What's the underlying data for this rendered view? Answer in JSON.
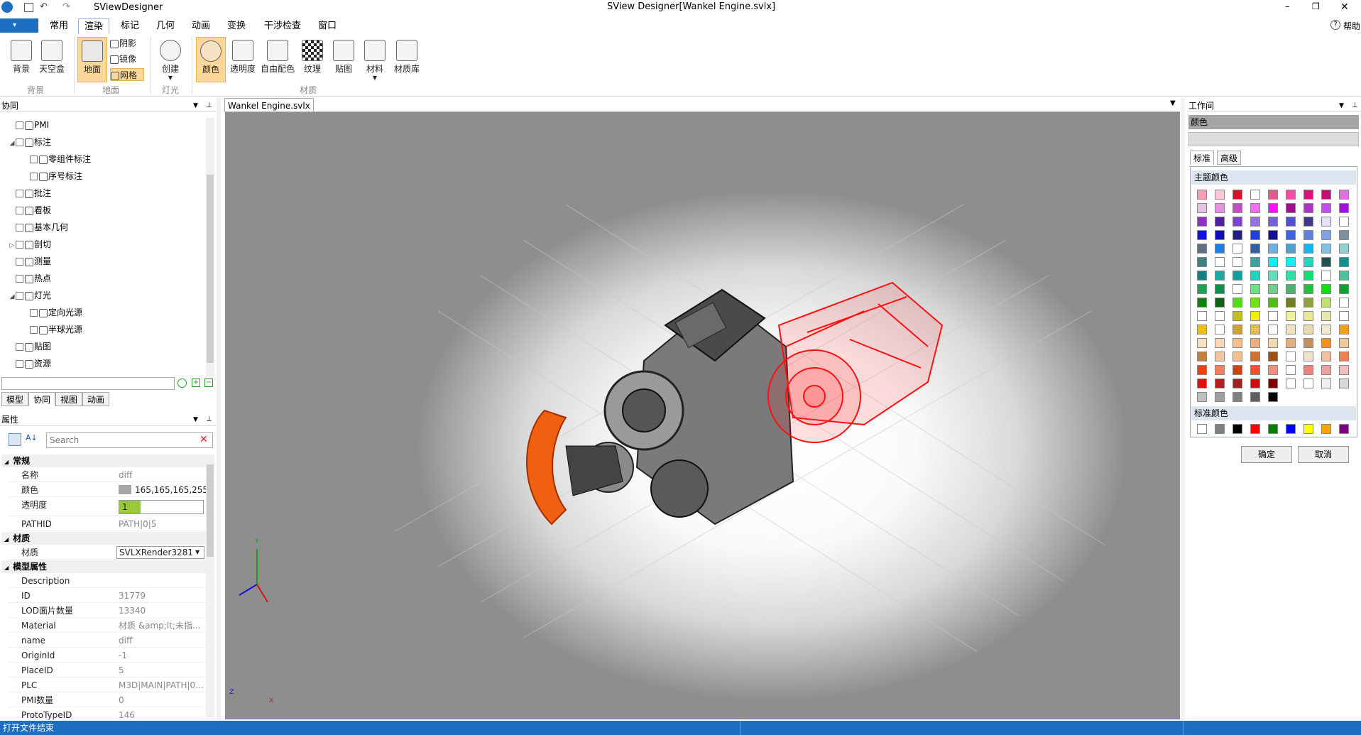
{
  "window": {
    "app_name": "SViewDesigner",
    "title": "SView Designer[Wankel Engine.svlx]",
    "help": "帮助"
  },
  "ribbon": {
    "tabs": [
      "常用",
      "渲染",
      "标记",
      "几何",
      "动画",
      "变换",
      "干涉检查",
      "窗口"
    ],
    "active_tab": "渲染",
    "groups": [
      {
        "name": "背景",
        "buttons": [
          "背景",
          "天空盒"
        ]
      },
      {
        "name": "地面",
        "buttons": [
          "地面"
        ],
        "small": [
          "阴影",
          "镜像",
          "网格"
        ]
      },
      {
        "name": "灯光",
        "buttons": [
          "创建"
        ]
      },
      {
        "name": "材质",
        "buttons": [
          "颜色",
          "透明度",
          "自由配色",
          "纹理",
          "贴图",
          "材料",
          "材质库"
        ]
      }
    ]
  },
  "left_top": {
    "header": "协同",
    "tree": [
      {
        "label": "PMI",
        "level": 0,
        "expander": ""
      },
      {
        "label": "标注",
        "level": 0,
        "expander": "◢"
      },
      {
        "label": "零组件标注",
        "level": 1,
        "expander": ""
      },
      {
        "label": "序号标注",
        "level": 1,
        "expander": ""
      },
      {
        "label": "批注",
        "level": 0,
        "expander": ""
      },
      {
        "label": "看板",
        "level": 0,
        "expander": ""
      },
      {
        "label": "基本几何",
        "level": 0,
        "expander": ""
      },
      {
        "label": "剖切",
        "level": 0,
        "expander": "▷"
      },
      {
        "label": "测量",
        "level": 0,
        "expander": ""
      },
      {
        "label": "热点",
        "level": 0,
        "expander": ""
      },
      {
        "label": "灯光",
        "level": 0,
        "expander": "◢"
      },
      {
        "label": "定向光源",
        "level": 1,
        "expander": ""
      },
      {
        "label": "半球光源",
        "level": 1,
        "expander": ""
      },
      {
        "label": "贴图",
        "level": 0,
        "expander": ""
      },
      {
        "label": "资源",
        "level": 0,
        "expander": ""
      }
    ],
    "bottom_tabs": [
      "模型",
      "协同",
      "视图",
      "动画"
    ],
    "active_bottom_tab": "协同"
  },
  "properties": {
    "header": "属性",
    "search_placeholder": "Search",
    "categories": [
      {
        "name": "常规",
        "rows": [
          {
            "key": "名称",
            "value": "diff"
          },
          {
            "key": "颜色",
            "value": "165,165,165,255"
          },
          {
            "key": "透明度",
            "value": "1"
          },
          {
            "key": "PATHID",
            "value": "PATH|0|5"
          }
        ]
      },
      {
        "name": "材质",
        "rows": [
          {
            "key": "材质",
            "value": "SVLXRender3281"
          }
        ]
      },
      {
        "name": "模型属性",
        "rows": [
          {
            "key": "Description",
            "value": ""
          },
          {
            "key": "ID",
            "value": "31779"
          },
          {
            "key": "LOD面片数量",
            "value": "13340"
          },
          {
            "key": "Material",
            "value": "材质 &amp;lt;未指..."
          },
          {
            "key": "name",
            "value": "diff"
          },
          {
            "key": "OriginId",
            "value": "-1"
          },
          {
            "key": "PlaceID",
            "value": "5"
          },
          {
            "key": "PLC",
            "value": "M3D|MAIN|PATH|0..."
          },
          {
            "key": "PMI数量",
            "value": "0"
          },
          {
            "key": "ProtoTypeID",
            "value": "146"
          }
        ]
      }
    ],
    "color_swatch": "#a5a5a5"
  },
  "document_tab": "Wankel Engine.svlx",
  "axes": {
    "y": "Y",
    "z": "Z",
    "x": "X"
  },
  "right_panel": {
    "header": "工作间",
    "section": "颜色",
    "tabs": [
      "标准",
      "高级"
    ],
    "theme_label": "主题颜色",
    "standard_label": "标准颜色",
    "ok": "确定",
    "cancel": "取消",
    "theme_colors": [
      [
        "#f4a0b4",
        "#f8c8d8",
        "#d8102a",
        "#ffffff",
        "#e05a90",
        "#f050a0",
        "#e0107a",
        "#c01070",
        "#e070e0"
      ],
      [
        "#e8c0e0",
        "#e890e0",
        "#c050c0",
        "#f070f0",
        "#ff10ff",
        "#a0108a",
        "#b030c8",
        "#c050e8",
        "#a010e0"
      ],
      [
        "#9030c0",
        "#5020a0",
        "#8040d0",
        "#9870e0",
        "#7060e0",
        "#5050d0",
        "#403890",
        "#e0e0f8",
        "#ffffff"
      ],
      [
        "#1010e0",
        "#1010b0",
        "#202080",
        "#2040e0",
        "#101090",
        "#4060e0",
        "#6080e0",
        "#80a0e0",
        "#8090a0"
      ],
      [
        "#607080",
        "#2080e0",
        "#ffffff",
        "#3060a0",
        "#70b0e0",
        "#50a0d0",
        "#10b8f0",
        "#80c0e0",
        "#90d0d0"
      ],
      [
        "#408080",
        "#ffffff",
        "#ffffff",
        "#40a0a0",
        "#10f0f0",
        "#10f0f0",
        "#20d8c0",
        "#205050",
        "#109090"
      ],
      [
        "#108080",
        "#20a8a0",
        "#10a0a0",
        "#20d0c0",
        "#60e0c0",
        "#30e0a0",
        "#10e070",
        "#ffffff",
        "#50c0a0"
      ],
      [
        "#20a050",
        "#109050",
        "#ffffff",
        "#70e080",
        "#70d090",
        "#50b070",
        "#20c040",
        "#10e010",
        "#10a030"
      ],
      [
        "#108010",
        "#106010",
        "#50e010",
        "#70e010",
        "#50c010",
        "#708020",
        "#90a040",
        "#c0e070",
        "#ffffff"
      ],
      [
        "#ffffff",
        "#ffffff",
        "#c0c020",
        "#f0f010",
        "#ffffff",
        "#f0f0a0",
        "#e8e890",
        "#e8e8b0",
        "#ffffff"
      ],
      [
        "#f0c010",
        "#ffffff",
        "#d0a030",
        "#e0c050",
        "#ffffff",
        "#f0e0c0",
        "#e8d8b0",
        "#f0e8d0",
        "#f0a010"
      ],
      [
        "#f8e0c0",
        "#f8d8b8",
        "#f0c090",
        "#e8b080",
        "#f0d8b0",
        "#e0b080",
        "#c09060",
        "#f09020",
        "#f0c8a0"
      ],
      [
        "#c08040",
        "#f0c8a0",
        "#f0c090",
        "#d07030",
        "#a05010",
        "#ffffff",
        "#f0e0d0",
        "#f0c0a0",
        "#f08050"
      ],
      [
        "#f04010",
        "#f08060",
        "#d04010",
        "#f05030",
        "#f09080",
        "#ffffff",
        "#f08080",
        "#f0a0a0",
        "#f0c0c0"
      ],
      [
        "#e01010",
        "#b02020",
        "#a02020",
        "#d01010",
        "#800000",
        "#ffffff",
        "#ffffff",
        "#f0f0f0",
        "#d8d8d8"
      ],
      [
        "#c0c0c0",
        "#a0a0a0",
        "#808080",
        "#606060",
        "#000000"
      ]
    ],
    "standard_colors": [
      "#ffffff",
      "#808080",
      "#000000",
      "#ff0000",
      "#008000",
      "#0000ff",
      "#ffff00",
      "#ffa500",
      "#800080"
    ]
  },
  "status": "打开文件结束"
}
